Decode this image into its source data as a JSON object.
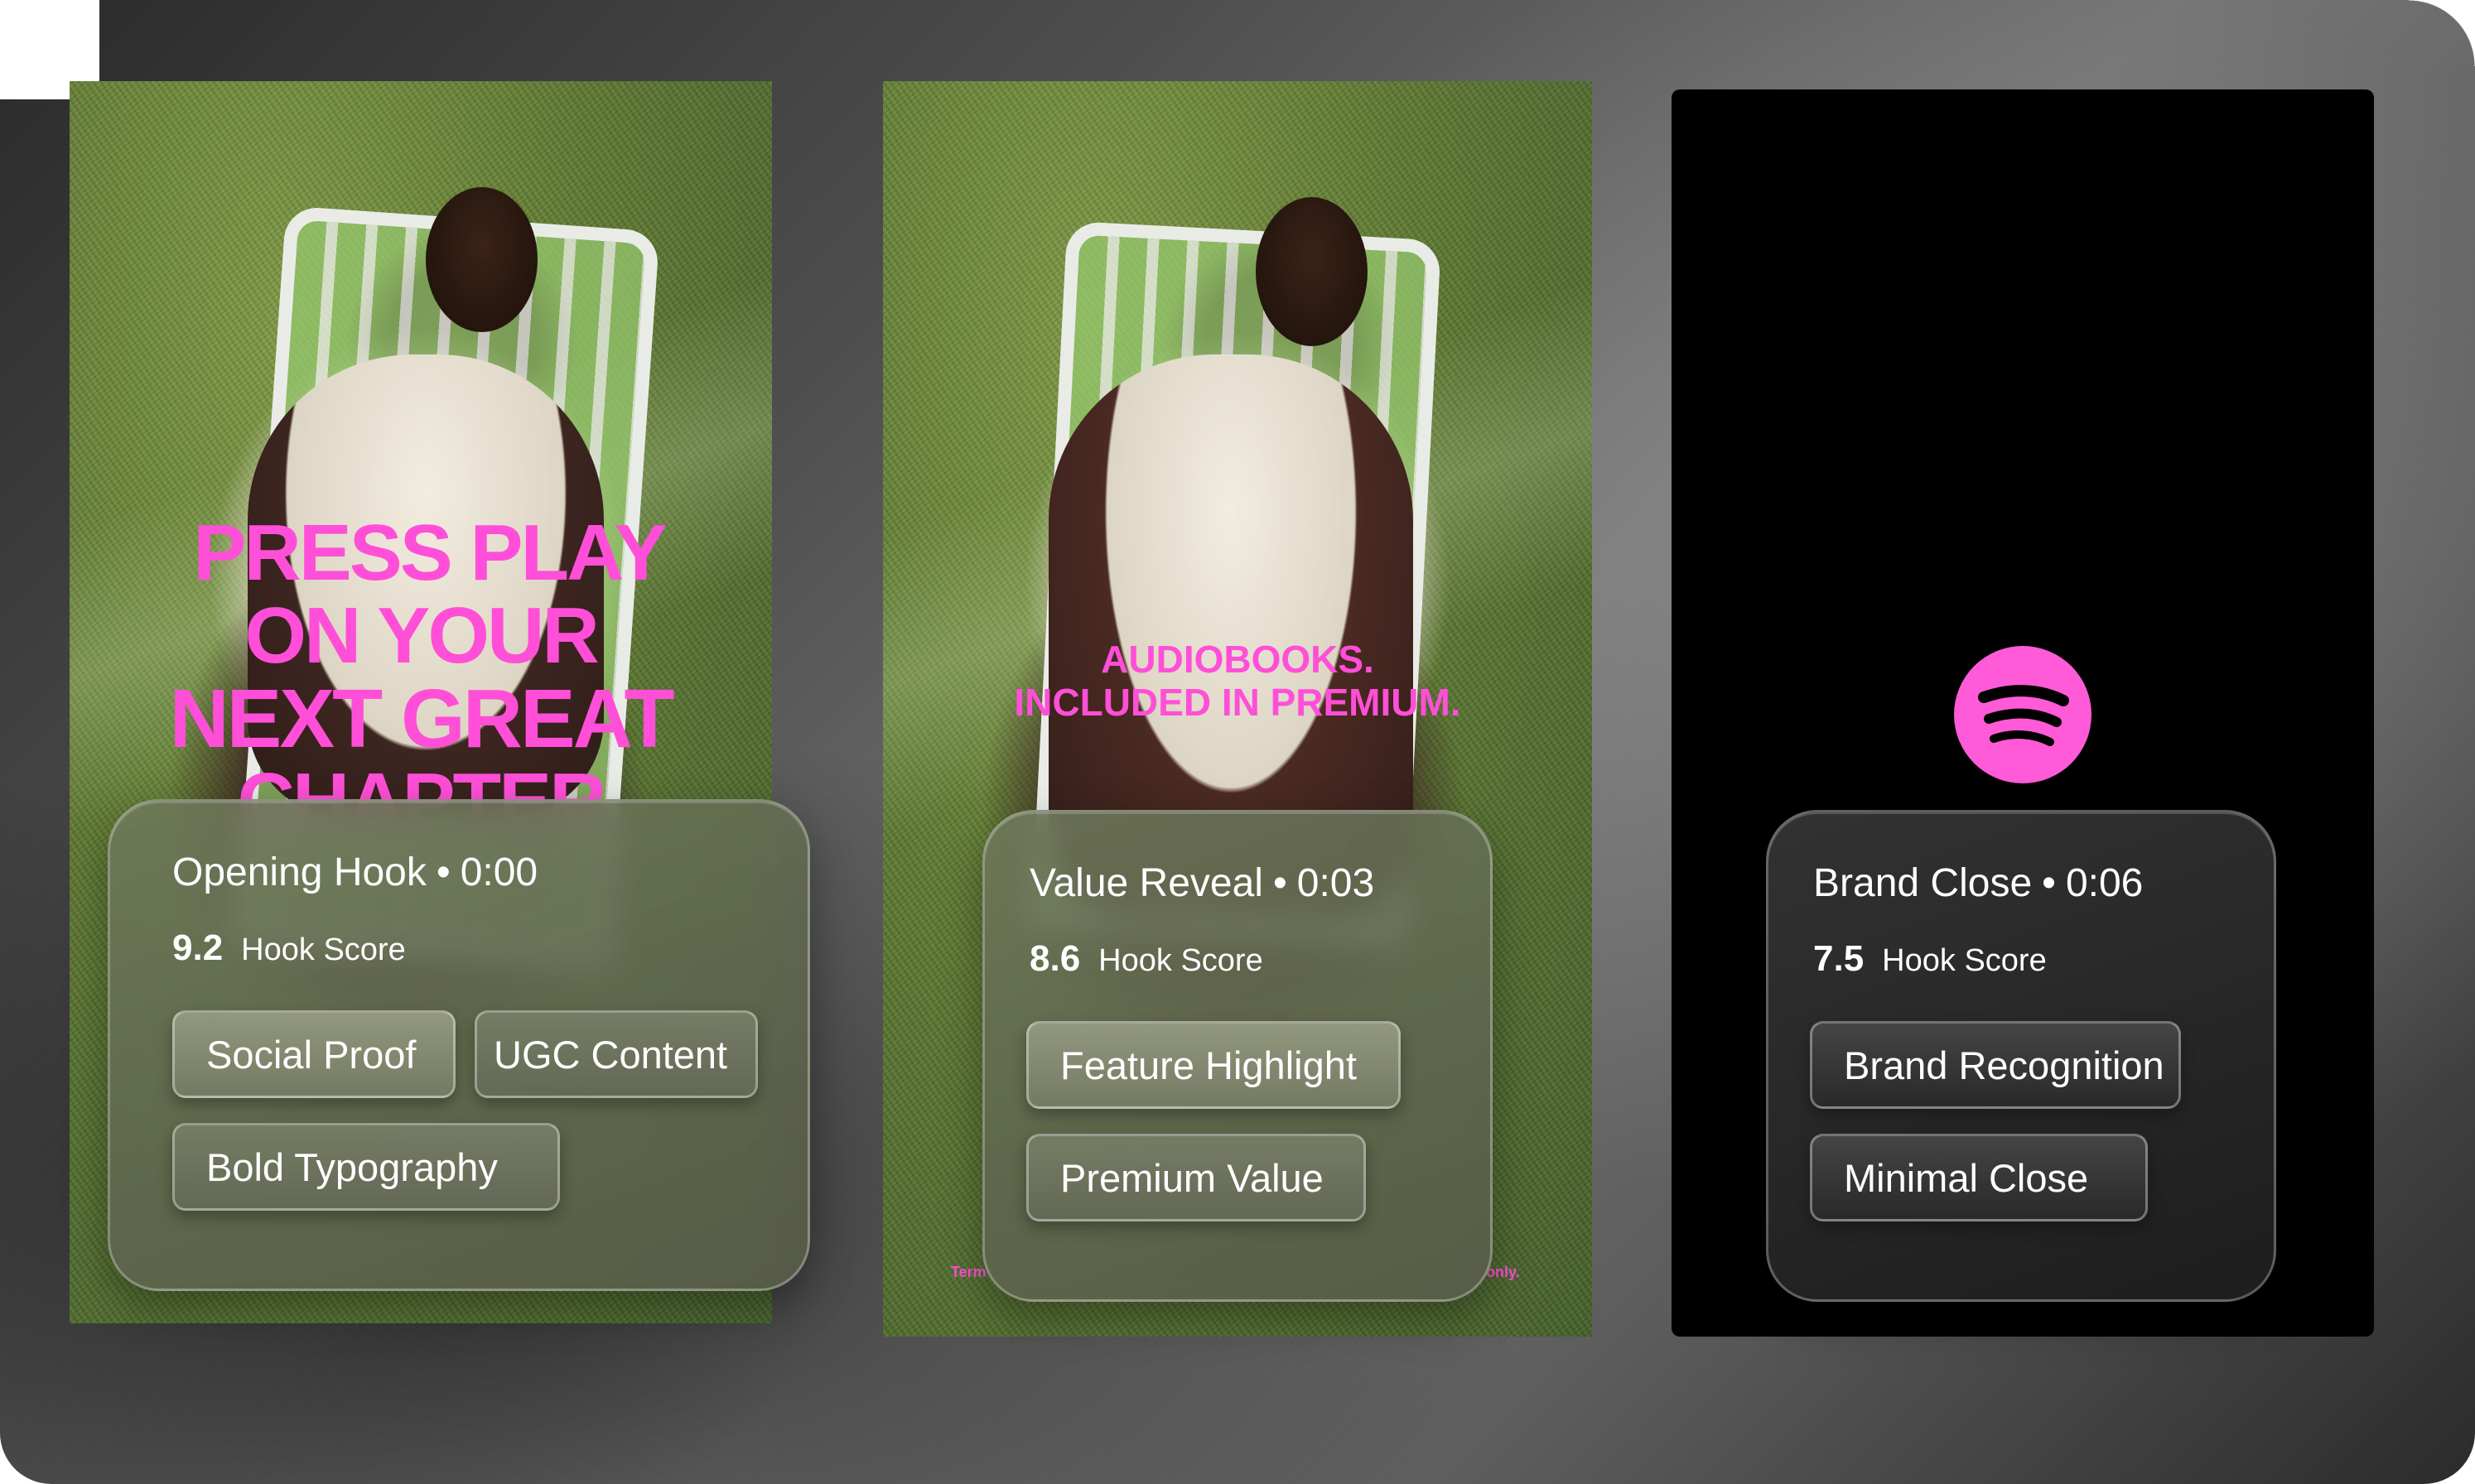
{
  "frames": [
    {
      "headline": [
        "PRESS PLAY",
        "ON YOUR",
        "NEXT GREAT",
        "CHAPTER"
      ],
      "card": {
        "segment": "Opening Hook",
        "time": "0:00",
        "score": "9.2",
        "score_label": "Hook Score",
        "tags": [
          "Social Proof",
          "UGC Content",
          "Bold Typography"
        ]
      }
    },
    {
      "headline": [
        "AUDIOBOOKS.",
        "INCLUDED IN PREMIUM."
      ],
      "legal_left": "Term",
      "legal_right": "only.",
      "card": {
        "segment": "Value Reveal",
        "time": "0:03",
        "score": "8.6",
        "score_label": "Hook Score",
        "tags": [
          "Feature Highlight",
          "Premium Value"
        ]
      }
    },
    {
      "logo_icon": "spotify-logo-icon",
      "card": {
        "segment": "Brand Close",
        "time": "0:06",
        "score": "7.5",
        "score_label": "Hook Score",
        "tags": [
          "Brand Recognition",
          "Minimal Close"
        ]
      }
    }
  ],
  "separator": "•",
  "colors": {
    "accent_pink": "#ff4fd8",
    "grass_green": "#5f7a32",
    "card_green": "#6e785a",
    "card_dark": "#2a2a2a"
  }
}
